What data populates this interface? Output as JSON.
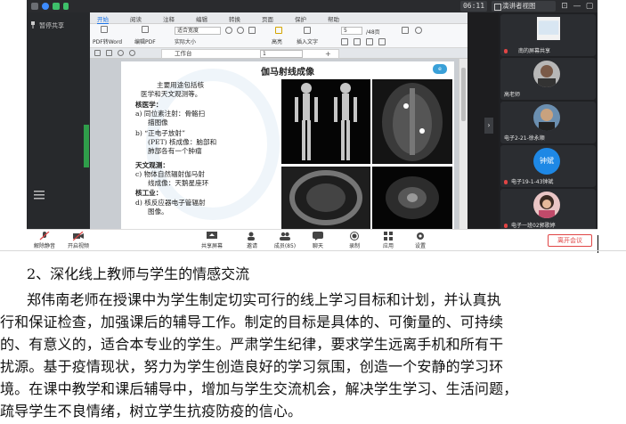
{
  "meeting": {
    "clock": "06:11",
    "speaker_view": "演讲者视图",
    "left_label": "暂停共享",
    "leave": "离开会议"
  },
  "doc_window": {
    "tabs": [
      "开始",
      "阅读",
      "注释",
      "编辑",
      "转换",
      "页面",
      "保护",
      "帮助"
    ],
    "ribbon": {
      "pdf_to_word": "PDF转Word",
      "edit_pdf": "编辑PDF",
      "fit_width": "适合宽度",
      "actual_size": "实际大小",
      "page_value": "5",
      "page_total": "/48页",
      "highlight": "高亮",
      "insert_text": "插入文字"
    },
    "tab_label": "工作台",
    "page_box": "1"
  },
  "slide": {
    "title": "伽马射线成像",
    "logo": "e",
    "lines": [
      "主要用途包括核",
      "医学和天文观测等。",
      "核医学：",
      "a) 同位素注射：骨骼扫",
      "描图像",
      "b) “正电子放射”",
      "(PET) 核成像：脑部和",
      "肺部各有一个肿瘤",
      "天文观测：",
      "c) 物体自然辐射伽马射",
      "线成像：天鹅星座环",
      "核工业：",
      "d) 核反应器电子管辐射",
      "图像。"
    ]
  },
  "participants": [
    {
      "name": "南的屏幕共享",
      "avatar": "share"
    },
    {
      "name": "高老师",
      "avatar": "photo"
    },
    {
      "name": "电子2-21-徐永顺",
      "avatar": "photo"
    },
    {
      "name": "电子19-1-43钟斌",
      "avatar": "text",
      "avatar_text": "钟斌",
      "avatar_color": "#1e88e5"
    },
    {
      "name": "电子一班02郭歌婷",
      "avatar": "photo"
    }
  ],
  "toolbar": {
    "mute": "解除静音",
    "video": "开启视频",
    "share": "共享屏幕",
    "invite": "邀请",
    "members": "成员(85)",
    "chat": "聊天",
    "record": "录制",
    "apps": "应用",
    "settings": "设置"
  },
  "article": {
    "heading": "2、深化线上教师与学生的情感交流",
    "lines": [
      "郑伟南老师在授课中为学生制定切实可行的线上学习目标和计划，并认真执",
      "行和保证检查，加强课后的辅导工作。制定的目标是具体的、可衡量的、可持续",
      "的、有意义的，适合本专业的学生。严肃学生纪律，要求学生远离手机和所有干",
      "扰源。基于疫情现状，努力为学生创造良好的学习氛围，创造一个安静的学习环",
      "境。在课中教学和课后辅导中，增加与学生交流机会，解决学生学习、生活问题，",
      "疏导学生不良情绪，树立学生抗疫防疫的信心。"
    ]
  },
  "colors": {
    "accent": "#1a73e8",
    "leave_red": "#e04545",
    "green_edge": "#2f9d4a"
  }
}
